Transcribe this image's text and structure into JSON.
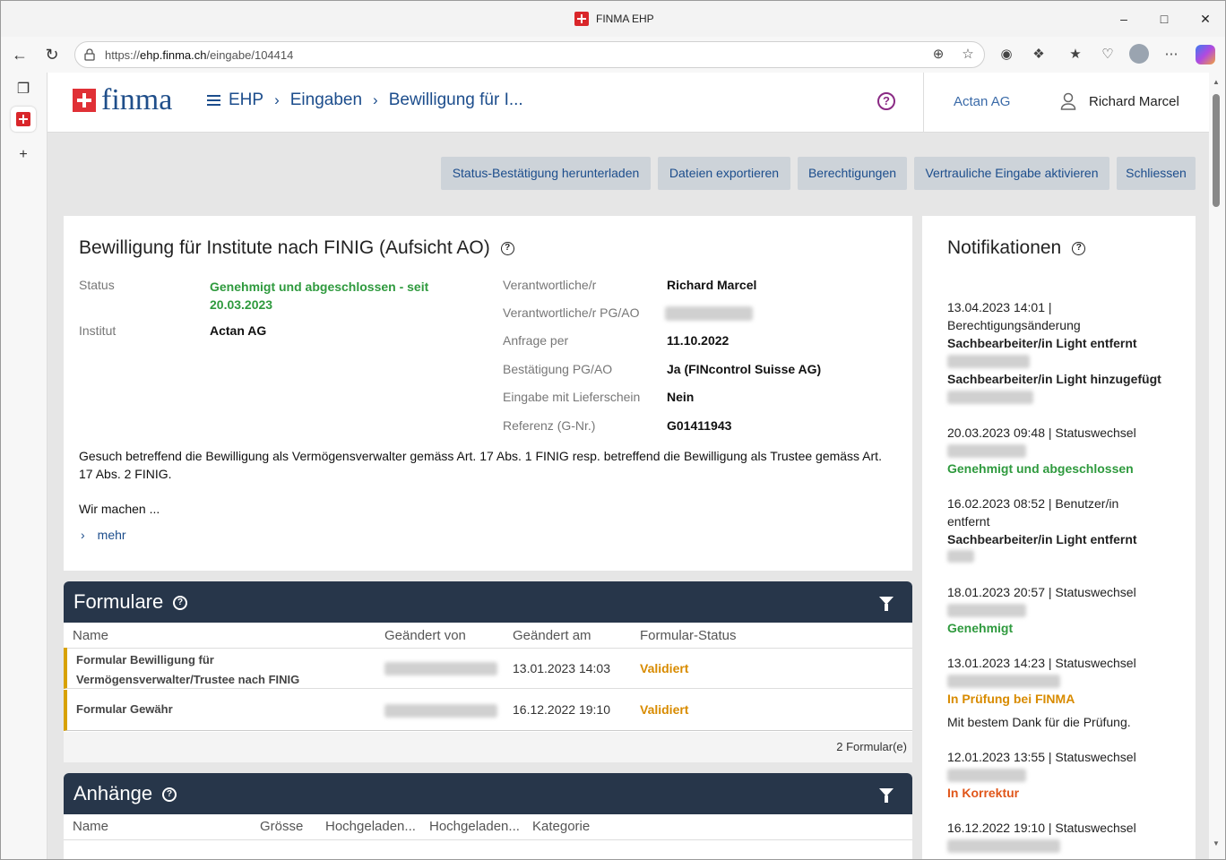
{
  "browser": {
    "window_title": "FINMA EHP",
    "url_prefix": "https://",
    "url_host": "ehp.finma.ch",
    "url_path": "/eingabe/104414"
  },
  "header": {
    "logo_text": "finma",
    "crumb_home": "EHP",
    "crumb_section": "Eingaben",
    "crumb_current": "Bewilligung für I...",
    "help": "?",
    "organisation": "Actan AG",
    "user": "Richard Marcel"
  },
  "toolbar": {
    "status_download": "Status-Bestätigung herunterladen",
    "export": "Dateien exportieren",
    "permissions": "Berechtigungen",
    "confidential": "Vertrauliche Eingabe aktivieren",
    "close": "Schliessen"
  },
  "detail": {
    "title": "Bewilligung für Institute nach FINIG (Aufsicht AO)",
    "status_label": "Status",
    "status_value_1": "Genehmigt und abgeschlossen - seit",
    "status_value_2": "20.03.2023",
    "institut_label": "Institut",
    "institut_value": "Actan AG",
    "responsible_label": "Verantwortliche/r",
    "responsible_value": "Richard Marcel",
    "responsible_pg_label": "Verantwortliche/r PG/AO",
    "request_label": "Anfrage per",
    "request_value": "11.10.2022",
    "confirm_label": "Bestätigung PG/AO",
    "confirm_value": "Ja (FINcontrol Suisse AG)",
    "delivery_label": "Eingabe mit Lieferschein",
    "delivery_value": "Nein",
    "reference_label": "Referenz (G-Nr.)",
    "reference_value": "G01411943",
    "description": "Gesuch betreffend die Bewilligung als Vermögensverwalter gemäss Art. 17 Abs. 1 FINIG resp. betreffend die Bewilligung als Trustee gemäss Art. 17 Abs. 2 FINIG.",
    "description_more": "Wir machen ...",
    "more_link": "mehr"
  },
  "formulare": {
    "title": "Formulare",
    "columns": [
      "Name",
      "Geändert von",
      "Geändert am",
      "Formular-Status"
    ],
    "rows": [
      {
        "name_1": "Formular Bewilligung für",
        "name_2": "Vermögensverwalter/Trustee nach FINIG",
        "date": "13.01.2023 14:03",
        "status": "Validiert"
      },
      {
        "name_1": "Formular Gewähr",
        "name_2": "",
        "date": "16.12.2022 19:10",
        "status": "Validiert"
      }
    ],
    "footer": "2 Formular(e)"
  },
  "anhaenge": {
    "title": "Anhänge",
    "columns": [
      "Name",
      "Grösse",
      "Hochgeladen...",
      "Hochgeladen...",
      "Kategorie"
    ]
  },
  "notifications": {
    "title": "Notifikationen",
    "items": [
      {
        "head": "13.04.2023 14:01 |",
        "head2": "Berechtigungsänderung",
        "l1": "Sachbearbeiter/in Light entfernt",
        "l2": "Sachbearbeiter/in Light hinzugefügt"
      },
      {
        "head": "20.03.2023 09:48 | Statuswechsel",
        "status": "Genehmigt und abgeschlossen"
      },
      {
        "head": "16.02.2023 08:52 | Benutzer/in",
        "head2": "entfernt",
        "l1": "Sachbearbeiter/in Light entfernt"
      },
      {
        "head": "18.01.2023 20:57 | Statuswechsel",
        "status": "Genehmigt"
      },
      {
        "head": "13.01.2023 14:23 | Statuswechsel",
        "status": "In Prüfung bei FINMA",
        "note": "Mit bestem Dank für die Prüfung."
      },
      {
        "head": "12.01.2023 13:55 | Statuswechsel",
        "status": "In Korrektur"
      },
      {
        "head": "16.12.2022 19:10 | Statuswechsel"
      }
    ]
  },
  "colors": {
    "brand_blue": "#1c4d8c",
    "dark_header": "#27364a",
    "green": "#2f9a3e",
    "orange": "#d88b00",
    "red": "#e0561a"
  }
}
